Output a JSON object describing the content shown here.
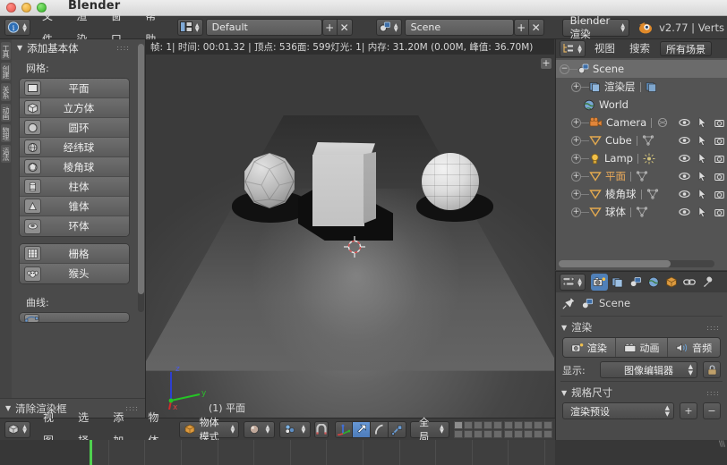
{
  "window": {
    "title": "Blender",
    "controls": [
      "close",
      "minimize",
      "zoom"
    ]
  },
  "topbar": {
    "editor_icon": "info-editor-icon",
    "menus": [
      "文件",
      "渲染",
      "窗口",
      "帮助"
    ],
    "screen_layout": {
      "icon": "screen-layout-icon",
      "value": "Default",
      "add_label": "+",
      "remove_label": "✕"
    },
    "scene": {
      "icon": "scene-icon",
      "value": "Scene",
      "add_label": "+",
      "remove_label": "✕"
    },
    "render_engine": {
      "value": "Blender 渲染"
    },
    "version": "v2.77 | Verts"
  },
  "infobar": {
    "text": "帧: 1| 时间: 00:01.32 | 顶点: 536面: 599灯光: 1| 内存: 31.20M (0.00M, 峰值: 36.70M)"
  },
  "toolshelf": {
    "vertical_tabs": [
      "工具",
      "创建",
      "关系",
      "动画",
      "物理",
      "语法"
    ],
    "panel_title": "添加基本体",
    "mesh_label": "网格:",
    "mesh_items": [
      {
        "label": "平面",
        "icon": "plane-icon"
      },
      {
        "label": "立方体",
        "icon": "cube-icon"
      },
      {
        "label": "圆环",
        "icon": "circle-icon"
      },
      {
        "label": "经纬球",
        "icon": "uvsphere-icon"
      },
      {
        "label": "棱角球",
        "icon": "icosphere-icon"
      },
      {
        "label": "柱体",
        "icon": "cylinder-icon"
      },
      {
        "label": "锥体",
        "icon": "cone-icon"
      },
      {
        "label": "环体",
        "icon": "torus-icon"
      }
    ],
    "mesh_items2": [
      {
        "label": "栅格",
        "icon": "grid-icon"
      },
      {
        "label": "猴头",
        "icon": "monkey-icon"
      }
    ],
    "curve_label": "曲线:",
    "bottom_panel_title": "清除渲染框"
  },
  "viewport": {
    "axis_labels": {
      "z": "z",
      "y": "y",
      "x": "x"
    },
    "active_object_label": "(1) 平面",
    "add_button": "+",
    "objects": [
      "icosphere",
      "cube",
      "uvsphere",
      "plane"
    ]
  },
  "outliner": {
    "header": {
      "display_mode_icon": "outliner-icon",
      "menus": [
        "视图",
        "搜索"
      ],
      "scope": "所有场景"
    },
    "rows": [
      {
        "name": "Scene",
        "icon": "scene-icon",
        "indent": 0,
        "expander": "minus",
        "selected": true,
        "orange": false,
        "has_restrict": false
      },
      {
        "name": "渲染层",
        "icon": "renderlayer-icon",
        "indent": 1,
        "expander": "plus",
        "selected": false,
        "orange": false,
        "has_restrict": false,
        "data_icon": "renderlayer-data-icon"
      },
      {
        "name": "World",
        "icon": "world-icon",
        "indent": 1,
        "expander": "none",
        "selected": false,
        "orange": false,
        "has_restrict": false
      },
      {
        "name": "Camera",
        "icon": "camera-icon",
        "indent": 1,
        "expander": "plus",
        "selected": false,
        "orange": false,
        "has_restrict": true,
        "data_icon": "camera-data-icon"
      },
      {
        "name": "Cube",
        "icon": "mesh-icon",
        "indent": 1,
        "expander": "plus",
        "selected": false,
        "orange": false,
        "has_restrict": true,
        "data_icon": "mesh-data-icon"
      },
      {
        "name": "Lamp",
        "icon": "lamp-icon",
        "indent": 1,
        "expander": "plus",
        "selected": false,
        "orange": false,
        "has_restrict": true,
        "data_icon": "lamp-data-icon"
      },
      {
        "name": "平面",
        "icon": "mesh-icon",
        "indent": 1,
        "expander": "plus",
        "selected": false,
        "orange": true,
        "has_restrict": true,
        "data_icon": "mesh-data-icon"
      },
      {
        "name": "棱角球",
        "icon": "mesh-icon",
        "indent": 1,
        "expander": "plus",
        "selected": false,
        "orange": false,
        "has_restrict": true,
        "data_icon": "mesh-data-icon"
      },
      {
        "name": "球体",
        "icon": "mesh-icon",
        "indent": 1,
        "expander": "plus",
        "selected": false,
        "orange": false,
        "has_restrict": true,
        "data_icon": "mesh-data-icon"
      }
    ],
    "restrict_icons": [
      "eye-icon",
      "cursor-arrow-icon",
      "camera-render-icon"
    ]
  },
  "properties": {
    "tabs": [
      {
        "icon": "render-camera-icon",
        "active": true
      },
      {
        "icon": "render-layers-icon",
        "active": false
      },
      {
        "icon": "scene-icon",
        "active": false
      },
      {
        "icon": "world-icon",
        "active": false
      },
      {
        "icon": "object-cube-icon",
        "active": false
      },
      {
        "icon": "constraint-link-icon",
        "active": false
      },
      {
        "icon": "modifier-wrench-icon",
        "active": false
      }
    ],
    "breadcrumb": {
      "pin_icon": "pin-icon",
      "scene_icon": "scene-icon",
      "label": "Scene"
    },
    "render_section": {
      "title": "渲染",
      "buttons": [
        {
          "label": "渲染",
          "icon": "render-image-icon"
        },
        {
          "label": "动画",
          "icon": "render-animation-icon"
        },
        {
          "label": "音频",
          "icon": "render-audio-icon"
        }
      ],
      "display_label": "显示:",
      "display_value": "图像编辑器",
      "lock_icon": "lock-icon"
    },
    "dimensions_section": {
      "title": "规格尺寸",
      "preset_value": "渲染预设",
      "add_label": "+",
      "remove_label": "−"
    }
  },
  "viewport_header": {
    "editor_icon": "view3d-editor-icon",
    "menus": [
      "视图",
      "选择",
      "添加",
      "物体"
    ],
    "mode": {
      "icon": "object-mode-icon",
      "value": "物体模式"
    },
    "shading": {
      "icon": "solid-shading-icon"
    },
    "pivot": {
      "icon": "pivot-median-icon"
    },
    "snap_toggle_icon": "magnet-icon",
    "manipulator": {
      "enabled_icon": "manipulator-icon",
      "translate_icon": "translate-arrow-icon",
      "rotate_icon": "rotate-arc-icon",
      "scale_icon": "scale-icon",
      "orientation": "全局"
    },
    "layers_label": "layers"
  },
  "colors": {
    "accent_blue": "#5080b8",
    "outliner_orange": "#e8a95a",
    "panel_bg": "#4a4a4a",
    "header_bg": "#3d3d3d",
    "playhead_green": "#4fd14f"
  }
}
